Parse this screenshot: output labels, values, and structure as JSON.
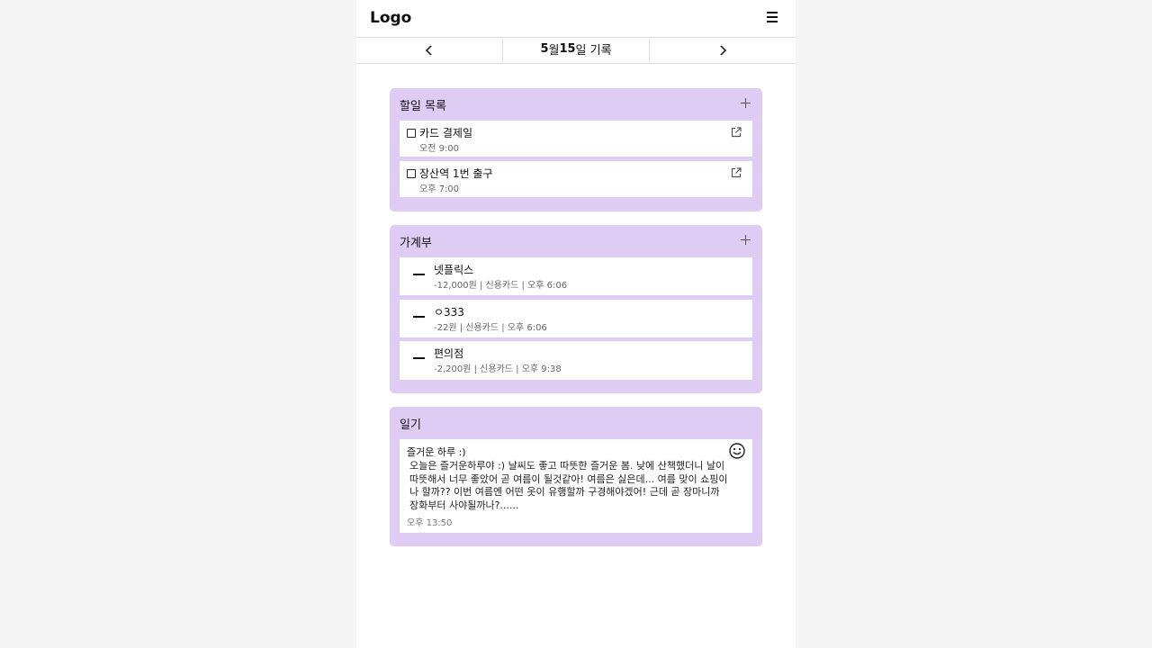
{
  "header": {
    "logo": "Logo"
  },
  "date_nav": {
    "month": "5",
    "month_unit": "월 ",
    "day": "15",
    "day_unit": "일 기록"
  },
  "todo": {
    "title": "할일 목록",
    "items": [
      {
        "title": "카드 결제일",
        "time": "오전 9:00"
      },
      {
        "title": "장산역 1번 출구",
        "time": "오후 7:00"
      }
    ]
  },
  "ledger": {
    "title": "가계부",
    "items": [
      {
        "title": "넷플릭스",
        "meta": "-12,000원 | 신용카드 | 오후 6:06"
      },
      {
        "title": "ㅇ333",
        "meta": "-22원 | 신용카드 | 오후 6:06"
      },
      {
        "title": "편의점",
        "meta": "-2,200원 | 신용카드 | 오후 9:38"
      }
    ]
  },
  "diary": {
    "title": "일기",
    "entry_title": "즐거운 하루 :)",
    "body": "오늘은 즐거운하루야 :) 날씨도 좋고 따뜻한 즐거운 봄. 낮에 산책했더니 날이 따뜻해서 너무 좋았어 곧 여름이 될것같아! 여름은 싫은데... 여름 맞이 쇼핑이나 할까?? 이번 여름엔 어떤 옷이 유행할까 구경해야겠어! 근데 곧 장마니까 장화부터 사야될까나?......",
    "time": "오후 13:50"
  },
  "icons": {
    "menu": "hamburger-menu-icon",
    "prev": "chevron-left-icon",
    "next": "chevron-right-icon",
    "add": "plus-icon",
    "open": "external-link-icon",
    "mood": "smile-icon",
    "expense": "minus-icon"
  },
  "colors": {
    "card_bg": "#dfccf5",
    "page_bg": "#f5f5f5"
  }
}
